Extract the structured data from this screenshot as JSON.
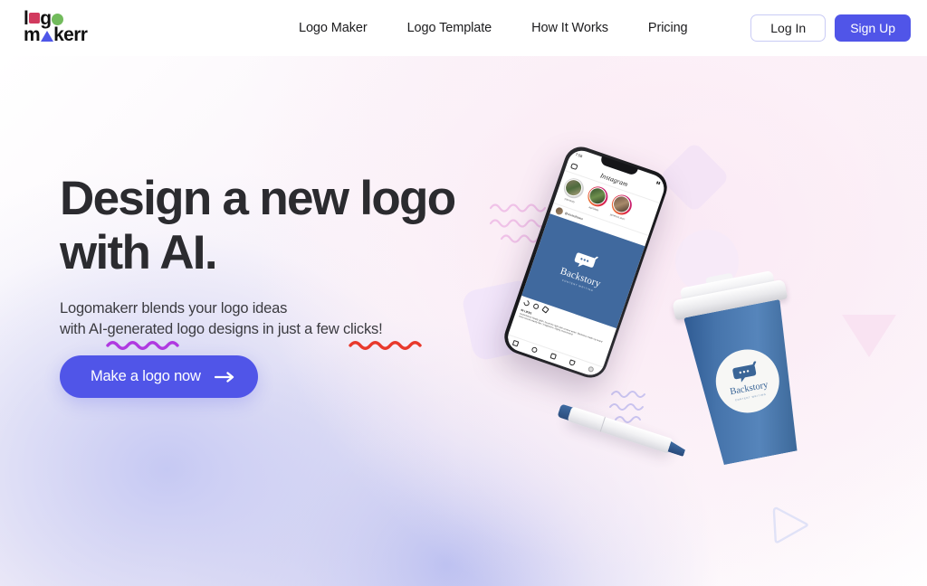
{
  "brand": {
    "line1_pre": "l",
    "line1_mid": "g",
    "line2_pre": "m",
    "line2_post": "kerr",
    "square_color": "#d13a5e",
    "circle_color": "#72bb5c",
    "triangle_color": "#4e57e8",
    "name": "logomakerr"
  },
  "nav": {
    "links": [
      {
        "label": "Logo Maker"
      },
      {
        "label": "Logo Template"
      },
      {
        "label": "How It Works"
      },
      {
        "label": "Pricing"
      }
    ],
    "login_label": "Log In",
    "signup_label": "Sign Up",
    "signup_color": "#5055e8",
    "login_border_color": "#c9cbf5"
  },
  "hero": {
    "headline_line1": "Design a new logo",
    "headline_line2": "with AI.",
    "headline_color": "#2b2b2f",
    "subcopy_line1": "Logomakerr blends your logo ideas",
    "subcopy_line2": "with AI-generated logo designs in just a few clicks!",
    "squiggle_purple_color": "#b03ae0",
    "squiggle_red_color": "#e8392c",
    "cta_label": "Make a logo now",
    "cta_color": "#5055e8"
  },
  "mockup": {
    "phone": {
      "status_time": "7:58",
      "app_name": "Instagram",
      "stories": [
        {
          "label": "yourstory"
        },
        {
          "label": "apriliaaa"
        },
        {
          "label": "jamesss.skrrr"
        }
      ],
      "post_author": "@soulsofstone",
      "post_brand": "Backstory",
      "post_brand_tagline": "CONTENT WRITING",
      "likes": "95 LIKES",
      "caption": "soulsofstone  Really glad I found the right web content writer. Backstory made my brand voice sound exactly like I imagined it. Highly recommend."
    },
    "cup": {
      "brand": "Backstory",
      "tagline": "CONTENT WRITING"
    },
    "marker": {
      "name": "marker-pen"
    }
  },
  "decor": {
    "diamond_color": "#f4e4f6",
    "circle_color": "#f7eaf8",
    "rounded_square_color": "#f2e6fa",
    "triangle_color": "#f9e3f2",
    "play_outline_color": "#e0e2f7",
    "wave_pink": "#f0c2e8",
    "wave_purple": "#c9c3ef"
  }
}
